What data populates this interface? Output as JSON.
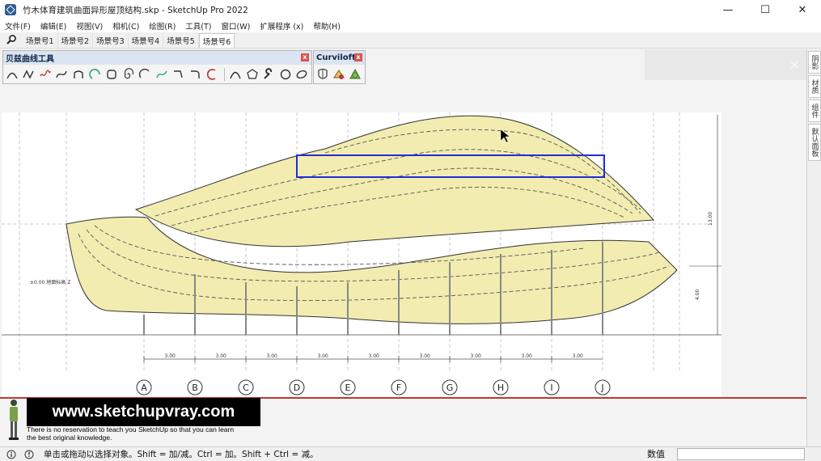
{
  "window": {
    "title": "竹木体育建筑曲面异形屋顶结构.skp - SketchUp Pro 2022",
    "minimize": "—",
    "maximize": "☐",
    "close": "✕"
  },
  "menu": [
    "文件(F)",
    "编辑(E)",
    "视图(V)",
    "相机(C)",
    "绘图(R)",
    "工具(T)",
    "窗口(W)",
    "扩展程序 (x)",
    "帮助(H)"
  ],
  "scene_tabs": [
    "场景号1",
    "场景号2",
    "场景号3",
    "场景号4",
    "场景号5",
    "场景号6"
  ],
  "active_scene": 5,
  "toolbar_bezier": {
    "title": "贝兹曲线工具",
    "close": "x",
    "icons": [
      "bezier-spline-icon",
      "polyline-curve-icon",
      "freehand-icon",
      "cubic-bezier-icon",
      "poly-spline-icon",
      "arc-icon",
      "rectangle-icon",
      "spiral-icon",
      "arc-3pt-icon",
      "catmull-spline-icon",
      "line-corner-icon",
      "arc-corner-icon",
      "circle-arc-icon",
      "curve-loft-icon",
      "polygon-icon",
      "wrench-icon",
      "circle-icon",
      "ellipse-icon"
    ]
  },
  "toolbar_curviloft": {
    "title": "Curviloft",
    "close": "x",
    "icons": [
      "loft-by-spline-icon",
      "loft-skinning-icon",
      "loft-contour-icon"
    ]
  },
  "tray_tabs": [
    "阴影",
    "材质",
    "组件",
    "默认面板"
  ],
  "drawing": {
    "grid_labels": [
      "A",
      "B",
      "C",
      "D",
      "E",
      "F",
      "G",
      "H",
      "I",
      "J"
    ],
    "dim_labels": [
      "3.00",
      "3.00",
      "3.00",
      "3.00",
      "3.00",
      "3.00",
      "3.00",
      "3.00",
      "3.00"
    ],
    "level_note": "±0.00 地面标高 Z",
    "right_dim_top": "13.00",
    "right_dim_bottom": "4.00"
  },
  "watermark": {
    "url": "www.sketchupvray.com",
    "line1": "There is no reservation to teach you SketchUp so that you can learn",
    "line2": "the best original knowledge."
  },
  "status": {
    "hint": "单击或拖动以选择对象。Shift = 加/减。Ctrl = 加。Shift + Ctrl = 减。",
    "vcb_label": "数值",
    "vcb_value": ""
  },
  "colors": {
    "selection": "#1f2ed8",
    "surface": "#f2ecb0",
    "accent_line": "#c0392b"
  }
}
